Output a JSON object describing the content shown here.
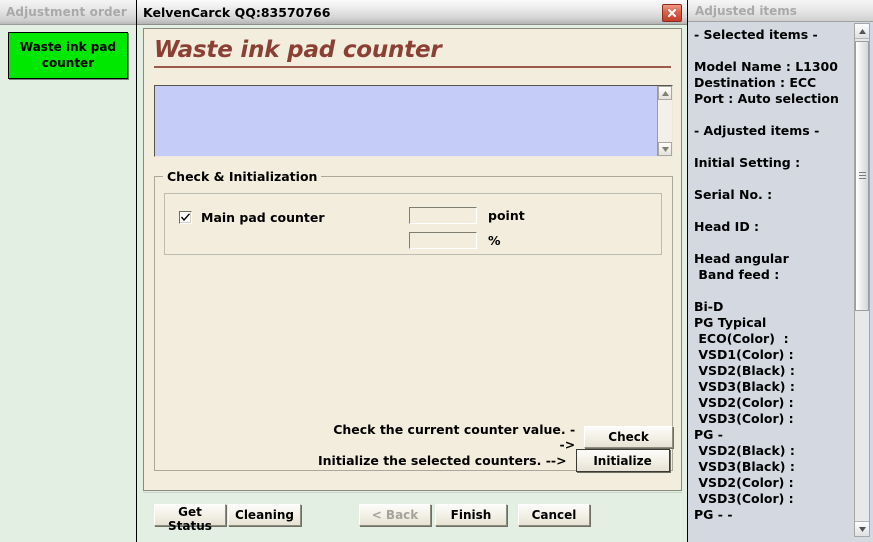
{
  "sidebar": {
    "title": "Adjustment order",
    "items": [
      {
        "label": "Waste ink pad\ncounter",
        "color": "#00e800"
      }
    ]
  },
  "dialog": {
    "title": "KelvenCarck QQ:83570766",
    "close_icon": "close-icon",
    "heading": "Waste ink pad counter",
    "log_text": "",
    "groupbox": {
      "legend": "Check & Initialization",
      "counter": {
        "checkbox_label": "Main pad counter",
        "checked": true,
        "point_value": "",
        "point_unit": "point",
        "percent_value": "",
        "percent_unit": "%"
      },
      "actions": [
        {
          "label": "Check the current counter value. -->",
          "button": "Check"
        },
        {
          "label": "Initialize the selected counters. -->",
          "button": "Initialize"
        }
      ]
    },
    "footer": {
      "get_status": "Get Status",
      "cleaning": "Cleaning",
      "back": "< Back",
      "finish": "Finish",
      "cancel": "Cancel"
    }
  },
  "right_panel": {
    "title": "Adjusted items",
    "lines": [
      "- Selected items -",
      "",
      "Model Name : L1300",
      "Destination : ECC",
      "Port : Auto selection",
      "",
      "- Adjusted items -",
      "",
      "Initial Setting :",
      "",
      "Serial No. :",
      "",
      "Head ID :",
      "",
      "Head angular",
      " Band feed :",
      "",
      "Bi-D",
      "PG Typical",
      " ECO(Color)  :",
      " VSD1(Color) :",
      " VSD2(Black) :",
      " VSD3(Black) :",
      " VSD2(Color) :",
      " VSD3(Color) :",
      "PG -",
      " VSD2(Black) :",
      " VSD3(Black) :",
      " VSD2(Color) :",
      " VSD3(Color) :",
      "PG - -"
    ]
  },
  "colors": {
    "panel_green": "#e3efe3",
    "dialog_cream": "#f2eddc",
    "log_blue": "#c6ccf8",
    "right_grey": "#d4d8e0",
    "heading_brown": "#8b4035",
    "selected_green": "#00e800",
    "close_red": "#c0402c"
  }
}
